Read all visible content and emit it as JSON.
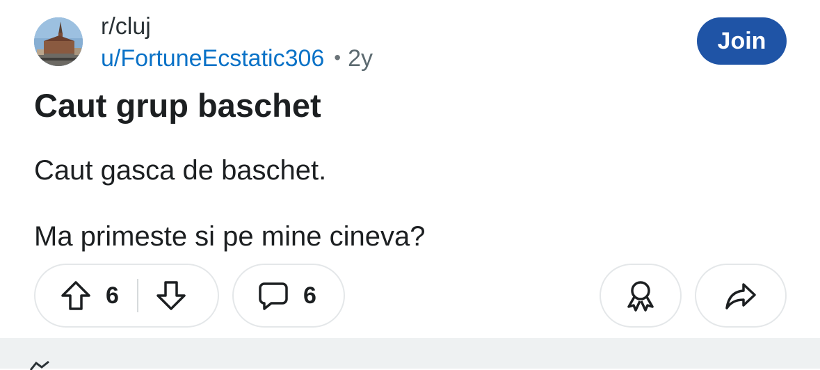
{
  "post": {
    "subreddit": "r/cluj",
    "username": "u/FortuneEcstatic306",
    "separator": "•",
    "age": "2y",
    "join_label": "Join",
    "title": "Caut grup baschet",
    "body": [
      "Caut gasca de baschet.",
      "Ma primeste si pe mine cineva?"
    ]
  },
  "actions": {
    "upvote_count": "6",
    "comment_count": "6"
  },
  "icons": {
    "upvote": "arrow-up-outline-icon",
    "downvote": "arrow-down-outline-icon",
    "comment": "speech-bubble-icon",
    "award": "award-ribbon-icon",
    "share": "share-arrow-icon"
  },
  "colors": {
    "join_button": "#1f54a6",
    "username": "#0a72c7",
    "pill_border": "#e4e7e9",
    "footer": "#eef1f2"
  }
}
